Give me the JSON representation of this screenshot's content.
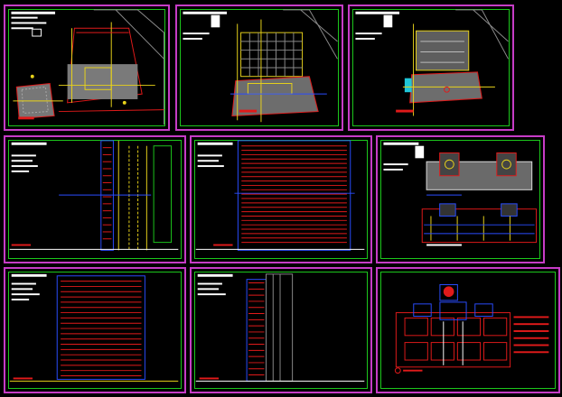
{
  "sheets": [
    {
      "id": "site-plan-1",
      "kind": "site-plan"
    },
    {
      "id": "site-plan-2",
      "kind": "site-plan"
    },
    {
      "id": "site-plan-3",
      "kind": "site-plan"
    },
    {
      "id": "side-elevation-1",
      "kind": "side-elevation"
    },
    {
      "id": "front-elevation",
      "kind": "front-elevation"
    },
    {
      "id": "foundation-details",
      "kind": "details"
    },
    {
      "id": "rear-elevation",
      "kind": "rear-elevation"
    },
    {
      "id": "side-elevation-2",
      "kind": "side-elevation"
    },
    {
      "id": "floor-plan",
      "kind": "floor-plan"
    }
  ],
  "colors": {
    "sheet_border": "#c63cc6",
    "inner_frame": "#1cc71c",
    "background": "#000000",
    "line_red": "#e01a1a",
    "line_yellow": "#e8d21a",
    "line_blue": "#2a4dff",
    "line_white": "#ffffff",
    "line_grey": "#8a8a8a",
    "line_cyan": "#1fc6d8"
  }
}
